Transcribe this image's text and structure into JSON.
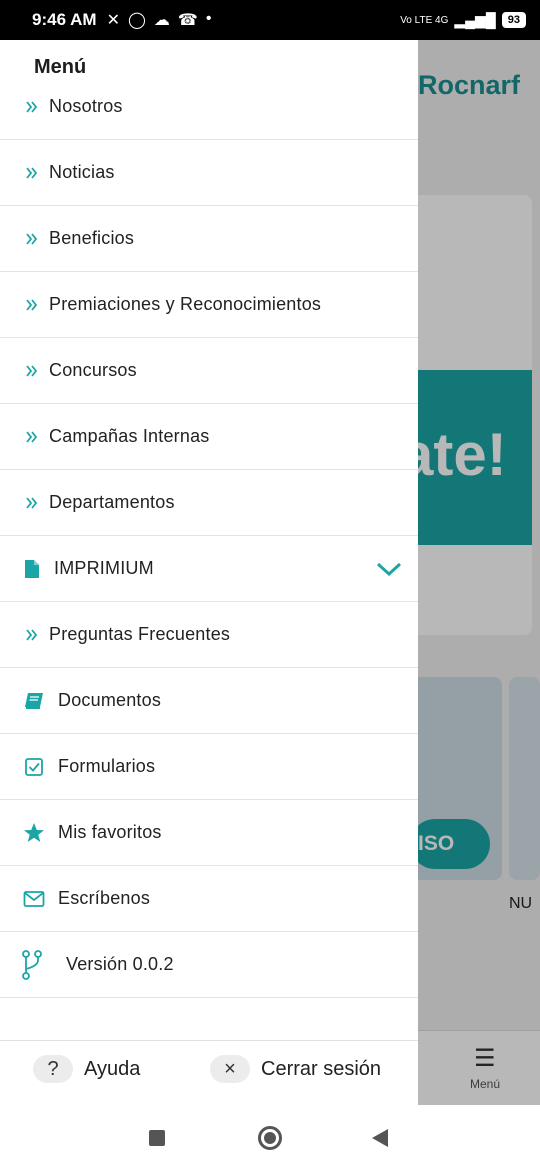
{
  "status_bar": {
    "time": "9:46 AM",
    "left_icons": [
      "mute-icon",
      "whatsapp-icon",
      "cloud-icon",
      "missed-call-icon",
      "dot-icon"
    ],
    "network": "Vo LTE 4G",
    "battery": "93"
  },
  "background": {
    "logo": "Rocnarf",
    "banner_text": "ate!",
    "promo_button": "ISO",
    "card_caption": "NU",
    "bottom_nav_label": "Menú"
  },
  "drawer": {
    "title": "Menú",
    "items": [
      {
        "label": "Nosotros",
        "icon": "double-chevron-icon"
      },
      {
        "label": "Noticias",
        "icon": "double-chevron-icon"
      },
      {
        "label": "Beneficios",
        "icon": "double-chevron-icon"
      },
      {
        "label": "Premiaciones y Reconocimientos",
        "icon": "double-chevron-icon"
      },
      {
        "label": "Concursos",
        "icon": "double-chevron-icon"
      },
      {
        "label": "Campañas Internas",
        "icon": "double-chevron-icon"
      },
      {
        "label": "Departamentos",
        "icon": "double-chevron-icon"
      },
      {
        "label": "IMPRIMIUM",
        "icon": "document-icon"
      },
      {
        "label": "Preguntas Frecuentes",
        "icon": "double-chevron-icon"
      },
      {
        "label": "Documentos",
        "icon": "book-icon"
      },
      {
        "label": "Formularios",
        "icon": "checkbox-icon"
      },
      {
        "label": "Mis favoritos",
        "icon": "star-icon"
      },
      {
        "label": "Escríbenos",
        "icon": "envelope-icon"
      },
      {
        "label": "Versión 0.0.2",
        "icon": "branch-icon"
      }
    ],
    "footer": {
      "help_label": "Ayuda",
      "help_icon": "?",
      "logout_label": "Cerrar sesión",
      "logout_icon": "×"
    }
  },
  "colors": {
    "accent": "#1ba5a7",
    "text": "#222222"
  }
}
